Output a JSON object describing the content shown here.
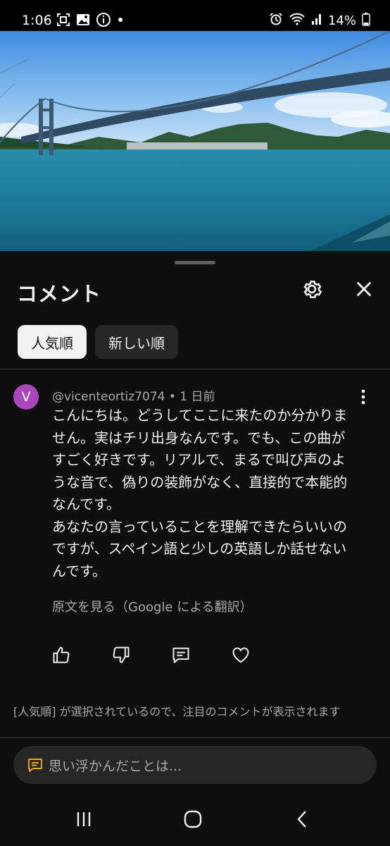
{
  "status_bar": {
    "time": "1:06",
    "battery": "14%",
    "left_icons": [
      "screenshot-icon",
      "gallery-icon",
      "info-icon",
      "dot-icon"
    ],
    "right_icons": [
      "alarm-icon",
      "wifi-icon",
      "signal-icon",
      "battery-icon"
    ]
  },
  "comments_panel": {
    "title": "コメント",
    "filters": [
      {
        "label": "人気順",
        "selected": true
      },
      {
        "label": "新しい順",
        "selected": false
      }
    ]
  },
  "comment": {
    "avatar_letter": "V",
    "avatar_color": "#ab47bc",
    "meta": "@vicenteortiz7074 • 1 日前",
    "lines": [
      "こんにちは。どうしてここに来たのか分かりま",
      "せん。実はチリ出身なんです。でも、この曲が",
      "すごく好きです。リアルで、まるで叫び声のよ",
      "うな音で、偽りの装飾がなく、直接的で本能的",
      "なんです。",
      "あなたの言っていることを理解できたらいいの",
      "ですが、スペイン語と少しの英語しか話せない",
      "んです。"
    ],
    "translate_link": "原文を見る（Google による翻訳）"
  },
  "notice": "[人気順] が選択されているので、注目のコメントが表示されます",
  "input": {
    "placeholder": "思い浮かんだことは..."
  },
  "colors": {
    "background": "#0f0f0f",
    "chip_active": "#f1f1f1",
    "chip_inactive": "#272727",
    "input_icon": "#f5a623"
  }
}
